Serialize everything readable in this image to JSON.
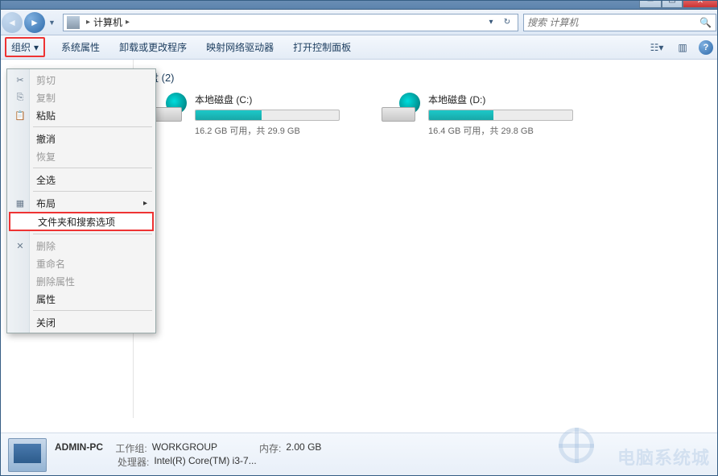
{
  "titlebar": {},
  "nav": {
    "breadcrumb_root_icon": "computer-icon",
    "breadcrumb_item": "计算机",
    "search_placeholder": "搜索 计算机"
  },
  "toolbar": {
    "organize": "组织",
    "system_properties": "系统属性",
    "uninstall_or_change": "卸载或更改程序",
    "map_network_drive": "映射网络驱动器",
    "open_control_panel": "打开控制面板"
  },
  "organize_menu": {
    "cut": "剪切",
    "copy": "复制",
    "paste": "粘贴",
    "undo": "撤消",
    "redo": "恢复",
    "select_all": "全选",
    "layout": "布局",
    "folder_search_options": "文件夹和搜索选项",
    "delete": "删除",
    "rename": "重命名",
    "remove_properties": "删除属性",
    "properties": "属性",
    "close": "关闭"
  },
  "content": {
    "section_title_suffix": "盘 (2)",
    "drives": [
      {
        "name": "本地磁盘 (C:)",
        "free": "16.2 GB 可用，共 29.9 GB",
        "fill_pct": 46
      },
      {
        "name": "本地磁盘 (D:)",
        "free": "16.4 GB 可用，共 29.8 GB",
        "fill_pct": 45
      }
    ]
  },
  "status": {
    "computer_name": "ADMIN-PC",
    "workgroup_label": "工作组:",
    "workgroup_value": "WORKGROUP",
    "memory_label": "内存:",
    "memory_value": "2.00 GB",
    "processor_label": "处理器:",
    "processor_value": "Intel(R) Core(TM) i3-7..."
  },
  "watermark": "电脑系统城"
}
